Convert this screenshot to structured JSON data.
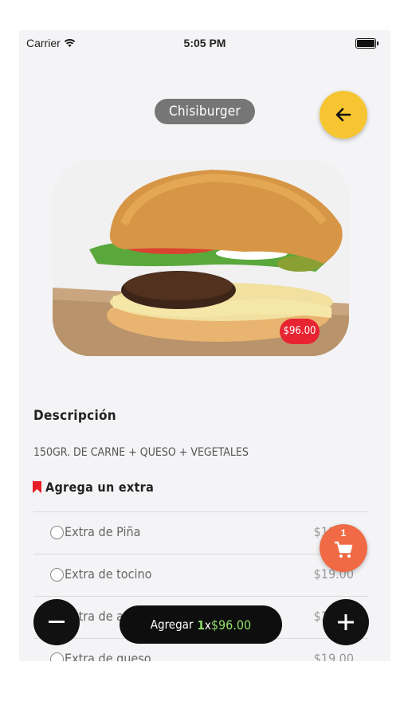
{
  "status_bar": {
    "carrier": "Carrier",
    "time": "5:05 PM"
  },
  "product": {
    "name": "Chisiburger",
    "price": "$96.00",
    "description_title": "Descripción",
    "description": "150GR. DE CARNE + QUESO + VEGETALES"
  },
  "extras": {
    "heading": "Agrega un extra",
    "items": [
      {
        "label": "Extra de Piña",
        "price": "$19.00"
      },
      {
        "label": "Extra de tocino",
        "price": "$19.00"
      },
      {
        "label": "Extra de arrachera",
        "price": "$19.00"
      },
      {
        "label": "Extra de queso",
        "price": "$19.00"
      }
    ]
  },
  "cart": {
    "count": "1"
  },
  "add_bar": {
    "label": "Agregar",
    "quantity": "1",
    "separator": "x",
    "total": "$96.00"
  },
  "colors": {
    "accent_yellow": "#f6c531",
    "cart_orange": "#ef6a45",
    "price_red": "#e82432",
    "total_green": "#8ee06a"
  },
  "icons": {
    "back": "arrow-left-icon",
    "cart": "cart-icon",
    "minus": "minus-icon",
    "plus": "plus-icon"
  }
}
